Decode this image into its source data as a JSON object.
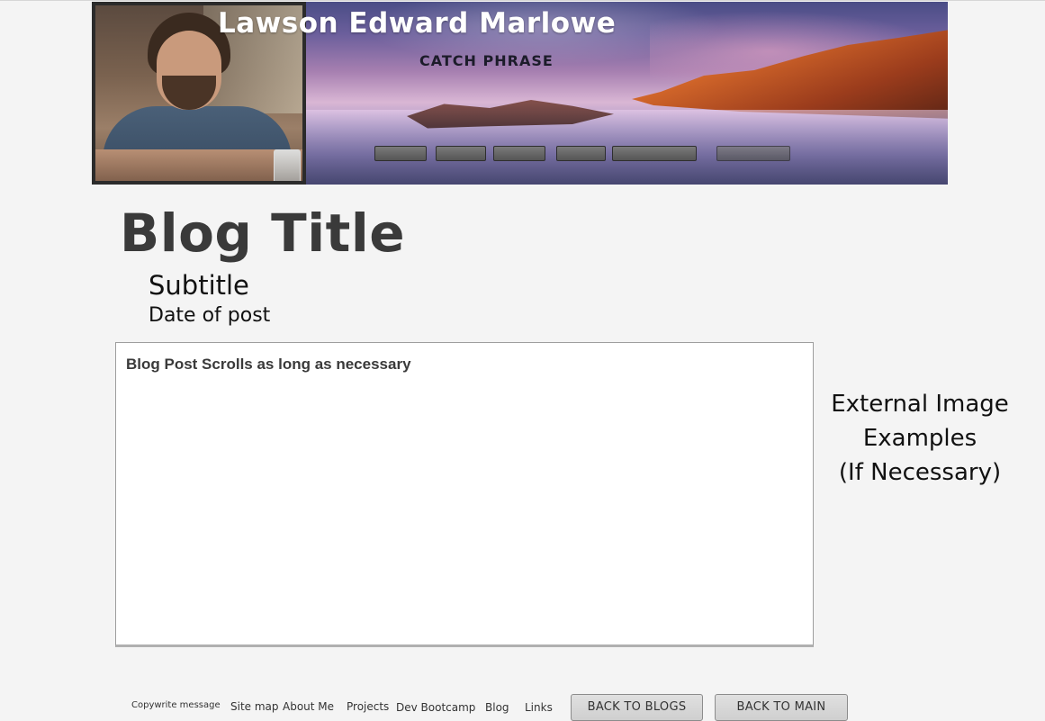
{
  "header": {
    "site_title": "Lawson Edward Marlowe",
    "catch_phrase": "CATCH PHRASE",
    "nav_buttons": [
      "",
      "",
      "",
      "",
      "",
      ""
    ]
  },
  "post": {
    "title": "Blog Title",
    "subtitle": "Subtitle",
    "date": "Date of post",
    "body": "Blog Post Scrolls as long as necessary"
  },
  "sidebar": {
    "external_images": [
      "External Image",
      "Examples",
      "(If Necessary)"
    ]
  },
  "footer": {
    "copyright": "Copywrite message",
    "links": [
      "Site map",
      "About Me",
      "Projects",
      "Dev Bootcamp",
      "Blog",
      "Links"
    ],
    "back_to_blogs": "BACK TO BLOGS",
    "back_to_main": "BACK TO MAIN"
  }
}
